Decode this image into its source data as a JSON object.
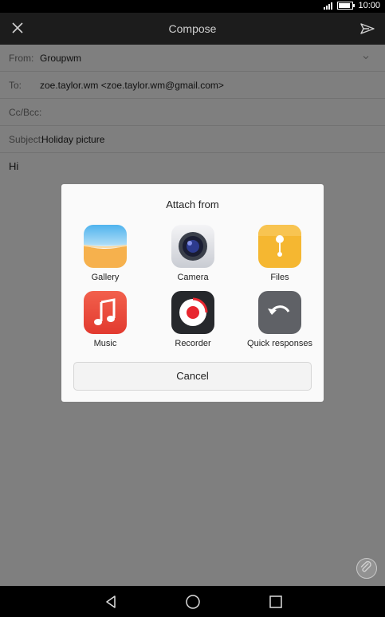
{
  "status": {
    "time": "10:00"
  },
  "header": {
    "title": "Compose"
  },
  "form": {
    "from_label": "From:",
    "from_value": "Groupwm",
    "to_label": "To:",
    "to_value": "zoe.taylor.wm <zoe.taylor.wm@gmail.com>",
    "ccbcc_label": "Cc/Bcc:",
    "subject_label": "Subject:",
    "subject_value": "Holiday picture",
    "body": "Hi"
  },
  "dialog": {
    "title": "Attach from",
    "options": [
      {
        "label": "Gallery",
        "icon": "gallery-icon"
      },
      {
        "label": "Camera",
        "icon": "camera-icon"
      },
      {
        "label": "Files",
        "icon": "files-icon"
      },
      {
        "label": "Music",
        "icon": "music-icon"
      },
      {
        "label": "Recorder",
        "icon": "recorder-icon"
      },
      {
        "label": "Quick responses",
        "icon": "quick-responses-icon"
      }
    ],
    "cancel": "Cancel"
  },
  "colors": {
    "topbar": "#1c1c1c",
    "scrim": "rgba(0,0,0,0.5)",
    "gallery_sky": "#5ab8ef",
    "gallery_sand": "#f6b14d",
    "files": "#f5b731",
    "music": "#ee4b3b",
    "recorder_red": "#e8262f",
    "quick_gray": "#5f6166"
  }
}
